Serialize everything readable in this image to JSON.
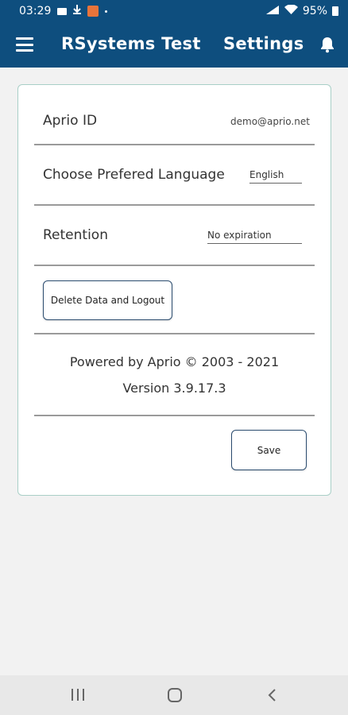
{
  "status_bar": {
    "time": "03:29",
    "battery": "95%"
  },
  "app_bar": {
    "app_title": "RSystems Test",
    "screen_title": "Settings"
  },
  "settings": {
    "aprio_id": {
      "label": "Aprio ID",
      "value": "demo@aprio.net"
    },
    "language": {
      "label": "Choose Prefered Language",
      "value": "English"
    },
    "retention": {
      "label": "Retention",
      "value": "No expiration"
    },
    "delete_button": "Delete Data and Logout",
    "powered_by": "Powered by Aprio © 2003 - 2021",
    "version": "Version 3.9.17.3",
    "save_button": "Save"
  },
  "colors": {
    "primary": "#0e4e7e",
    "card_border": "#a9cfc7",
    "background": "#f2f2f2"
  },
  "icons": [
    "menu-icon",
    "bell-icon",
    "wifi-icon",
    "battery-icon",
    "recent-apps-icon",
    "home-icon",
    "back-icon"
  ]
}
